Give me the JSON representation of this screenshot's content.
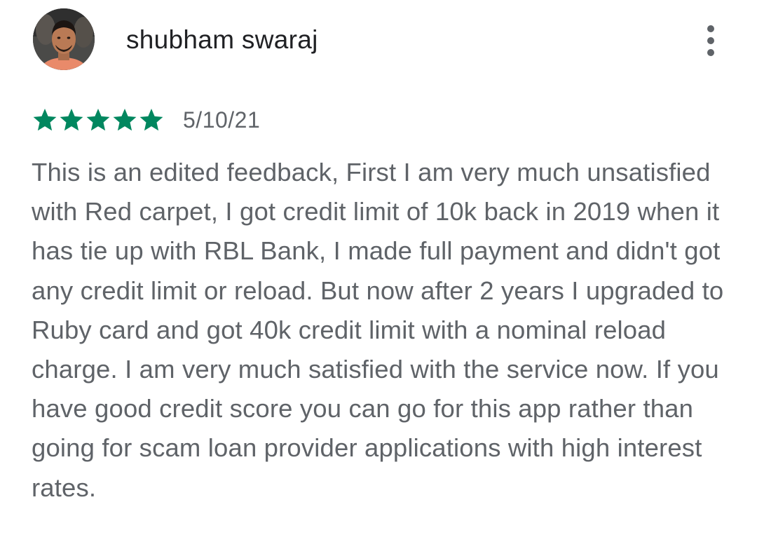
{
  "review": {
    "reviewer_name": "shubham swaraj",
    "avatar_icon": "user-avatar",
    "more_icon": "more-vert-icon",
    "rating": 5,
    "rating_max": 5,
    "star_color": "#01875f",
    "date": "5/10/21",
    "text": "This is an edited feedback, First I am very much unsatisfied with Red carpet, I got credit limit of 10k back in 2019 when it has tie up with RBL Bank, I made full payment and didn't got any credit limit or reload. But now after 2 years I upgraded to Ruby card and got 40k credit limit with a nominal reload charge. I am very much satisfied with the service now. If you have good credit score you can go for this app rather than going for scam loan provider applications with high interest rates."
  }
}
